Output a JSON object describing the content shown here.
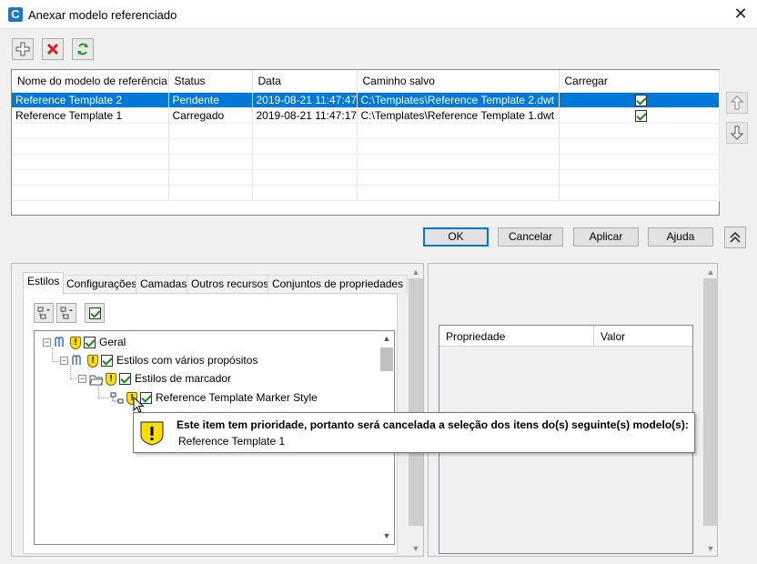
{
  "window": {
    "title": "Anexar modelo referenciado",
    "close_glyph": "✕"
  },
  "toolbar": {
    "add_icon": "plus-icon",
    "delete_icon": "delete-x-icon",
    "refresh_icon": "refresh-icon"
  },
  "table": {
    "columns": [
      "Nome do modelo de referência",
      "Status",
      "Data",
      "Caminho salvo",
      "Carregar"
    ],
    "rows": [
      {
        "name": "Reference Template 2",
        "status": "Pendente",
        "date": "2019-08-21 11:47:47",
        "path": "C:\\Templates\\Reference Template 2.dwt",
        "load": true,
        "selected": true
      },
      {
        "name": "Reference Template 1",
        "status": "Carregado",
        "date": "2019-08-21 11:47:17",
        "path": "C:\\Templates\\Reference Template 1.dwt",
        "load": true,
        "selected": false
      }
    ]
  },
  "buttons": {
    "ok": "OK",
    "cancel": "Cancelar",
    "apply": "Aplicar",
    "help": "Ajuda"
  },
  "tabs": [
    "Estilos",
    "Configurações",
    "Camadas",
    "Outros recursos",
    "Conjuntos de propriedades"
  ],
  "tree": {
    "nodes": [
      {
        "label": "Geral",
        "level": 0
      },
      {
        "label": "Estilos com vários propósitos",
        "level": 1
      },
      {
        "label": "Estilos de marcador",
        "level": 2
      },
      {
        "label": "Reference Template Marker Style",
        "level": 3
      }
    ]
  },
  "tooltip": {
    "message": "Este item tem prioridade, portanto será cancelada a seleção dos itens do(s) seguinte(s) modelo(s):",
    "item": "Reference Template 1"
  },
  "properties": {
    "col_property": "Propriedade",
    "col_value": "Valor"
  },
  "colors": {
    "selection": "#0078d7",
    "warning": "#ffde00",
    "check": "#1a8a1a"
  }
}
